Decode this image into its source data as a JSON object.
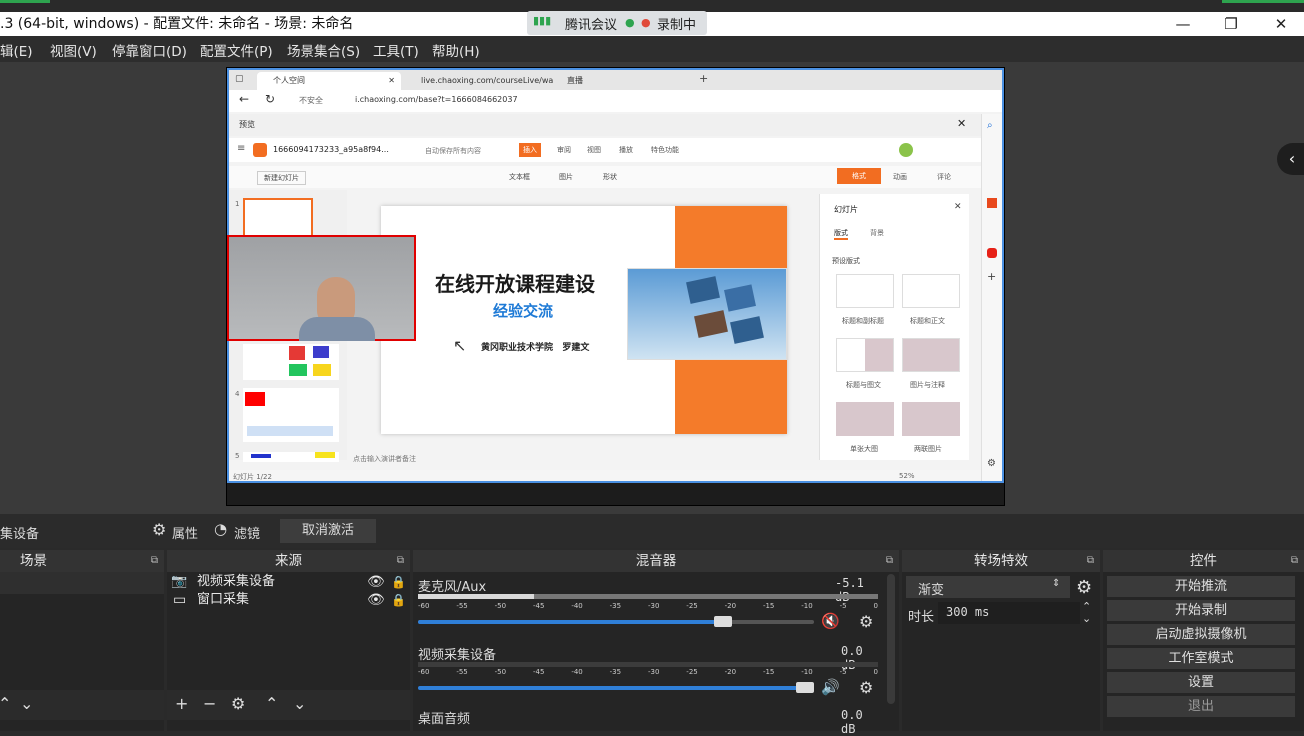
{
  "window": {
    "title": ".3 (64-bit, windows) - 配置文件: 未命名 - 场景: 未命名",
    "meeting_app": "腾讯会议",
    "recording_label": "录制中"
  },
  "menu": [
    "辑(E)",
    "视图(V)",
    "停靠窗口(D)",
    "配置文件(P)",
    "场景集合(S)",
    "工具(T)",
    "帮助(H)"
  ],
  "browser": {
    "tabs": [
      "个人空间",
      "live.chaoxing.com/courseLive/wa",
      "直播"
    ],
    "security": "不安全",
    "url": "i.chaoxing.com/base?t=1666084662037",
    "preview_label": "预览",
    "doc_name": "1666094173233_a95a8f94...",
    "autosave": "自动保存所有内容",
    "ribbon_tabs": [
      "插入",
      "审阅",
      "视图",
      "播放",
      "特色功能"
    ],
    "new_slide": "新建幻灯片",
    "tool_items": [
      "文本框",
      "图片",
      "形状"
    ],
    "panel_tabs": [
      "格式",
      "动画",
      "评论"
    ],
    "panel_title": "幻灯片",
    "panel_subtabs": [
      "版式",
      "背景"
    ],
    "layout_heading": "预设版式",
    "layouts": [
      "标题和副标题",
      "标题和正文",
      "标题与图文",
      "图片与注释",
      "单张大图",
      "两联图片"
    ],
    "slide_title": "在线开放课程建设",
    "slide_subtitle": "经验交流",
    "slide_author": "黄冈职业技术学院   罗建文",
    "notes_placeholder": "点击输入演讲者备注",
    "slide_counter": "幻灯片 1/22",
    "zoom": "52%",
    "thumb_numbers": [
      "1",
      "4",
      "5"
    ]
  },
  "toolbar": {
    "source_name": "集设备",
    "properties": "属性",
    "filters": "滤镜",
    "deactivate": "取消激活"
  },
  "docks": {
    "scenes": "场景",
    "sources": "来源",
    "mixer": "混音器",
    "transitions": "转场特效",
    "controls": "控件"
  },
  "sources": [
    "视频采集设备",
    "窗口采集"
  ],
  "mixer": {
    "channels": [
      {
        "name": "麦克风/Aux",
        "db": "-5.1 dB",
        "muted": true
      },
      {
        "name": "视频采集设备",
        "db": "0.0 dB",
        "muted": false
      },
      {
        "name": "桌面音频",
        "db": "0.0 dB",
        "muted": false
      }
    ],
    "scale": [
      "-60",
      "-55",
      "-50",
      "-45",
      "-40",
      "-35",
      "-30",
      "-25",
      "-20",
      "-15",
      "-10",
      "-5",
      "0"
    ]
  },
  "transitions": {
    "selected": "渐变",
    "duration_label": "时长",
    "duration_value": "300 ms"
  },
  "controls": [
    "开始推流",
    "开始录制",
    "启动虚拟摄像机",
    "工作室模式",
    "设置",
    "退出"
  ]
}
